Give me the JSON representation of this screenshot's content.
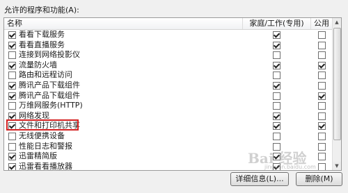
{
  "group_label": "允许的程序和功能(A):",
  "columns": {
    "name": "名称",
    "home": "家庭/工作(专用)",
    "public": "公用"
  },
  "rows": [
    {
      "label": "看看下载服务",
      "checked": true,
      "home": true,
      "public": false
    },
    {
      "label": "看看直播服务",
      "checked": true,
      "home": true,
      "public": false
    },
    {
      "label": "连接到网络投影仪",
      "checked": false,
      "home": false,
      "public": false
    },
    {
      "label": "流量防火墙",
      "checked": true,
      "home": true,
      "public": true
    },
    {
      "label": "路由和远程访问",
      "checked": false,
      "home": false,
      "public": false
    },
    {
      "label": "腾讯产品下载组件",
      "checked": true,
      "home": true,
      "public": false
    },
    {
      "label": "腾讯产品下载组件",
      "checked": true,
      "home": false,
      "public": true
    },
    {
      "label": "万维网服务(HTTP)",
      "checked": false,
      "home": false,
      "public": false
    },
    {
      "label": "网络发现",
      "checked": true,
      "home": true,
      "public": false
    },
    {
      "label": "文件和打印机共享",
      "checked": true,
      "home": true,
      "public": true,
      "highlighted": true
    },
    {
      "label": "无线便携设备",
      "checked": false,
      "home": false,
      "public": false
    },
    {
      "label": "性能日志和警报",
      "checked": false,
      "home": false,
      "public": false
    },
    {
      "label": "迅雷精简版",
      "checked": true,
      "home": true,
      "public": false
    },
    {
      "label": "迅雷看看播放器",
      "checked": true,
      "home": true,
      "public": false
    }
  ],
  "buttons": {
    "details": "详细信息(L)...",
    "remove": "删除(M)"
  },
  "watermark": {
    "logo_text": "Bai 经验",
    "sub_text": "jingyan.baidu.com"
  }
}
